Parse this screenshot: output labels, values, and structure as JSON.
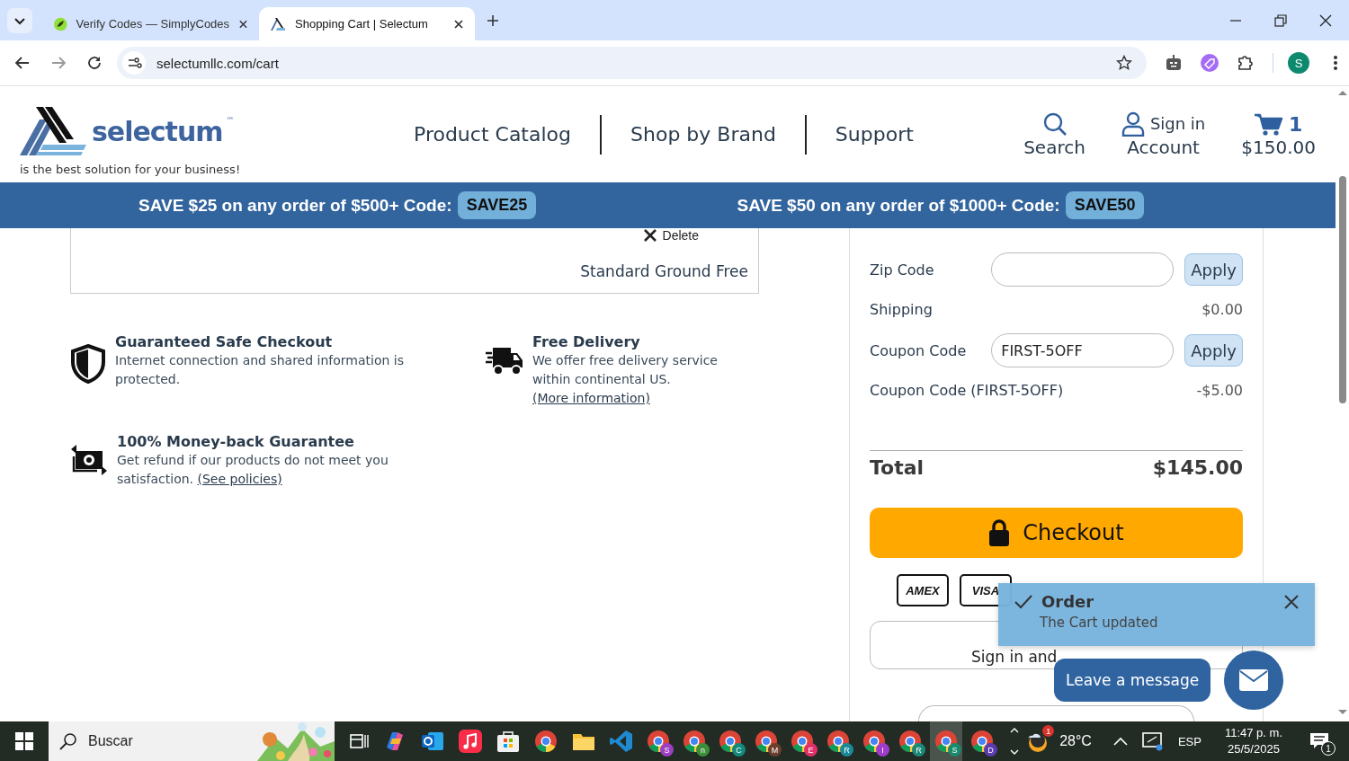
{
  "browser": {
    "tabs": [
      {
        "title": "Verify Codes — SimplyCodes",
        "selected": false
      },
      {
        "title": "Shopping Cart | Selectum",
        "selected": true
      }
    ],
    "url": "selectumllc.com/cart",
    "profile_initial": "S"
  },
  "header": {
    "logo_text": "selectum",
    "trademark": "™",
    "tagline": "is the best solution for your business!",
    "nav": [
      "Product Catalog",
      "Shop by Brand",
      "Support"
    ],
    "search_label": "Search",
    "sign_in": "Sign in",
    "account": "Account",
    "cart_count": "1",
    "cart_total": "$150.00"
  },
  "promo_banner": [
    {
      "text": "SAVE $25 on any order of $500+ Code:",
      "code": "SAVE25"
    },
    {
      "text": "SAVE $50 on any order of $1000+ Code:",
      "code": "SAVE50"
    }
  ],
  "cart_item": {
    "delete": "Delete",
    "shipping_method": "Standard Ground Free"
  },
  "features": [
    {
      "kind": "shield",
      "title": "Guaranteed Safe Checkout",
      "text": "Internet connection and shared information is protected."
    },
    {
      "kind": "truck",
      "title": "Free Delivery",
      "text": "We offer free delivery service within continental US.",
      "link": "(More information)"
    },
    {
      "kind": "money",
      "title": "100% Money-back Guarantee",
      "text": "Get refund if our products do not meet you satisfaction.",
      "link": "(See policies)"
    }
  ],
  "summary": {
    "rows": [
      {
        "kind": "input",
        "label": "Zip Code",
        "button": "Apply"
      },
      {
        "kind": "amount",
        "label": "Shipping",
        "amount": "$0.00"
      },
      {
        "kind": "input",
        "label": "Coupon Code",
        "value": "FIRST-5OFF",
        "button": "Apply"
      },
      {
        "kind": "amount",
        "label": "Coupon Code (FIRST-5OFF)",
        "amount": "-$5.00"
      }
    ],
    "total_label": "Total",
    "total": "$145.00",
    "checkout": "Checkout",
    "cards": [
      "AMEX",
      "VISA"
    ],
    "sign_in_checkout": "Sign in and"
  },
  "toast": {
    "title": "Order",
    "message": "The Cart updated"
  },
  "chat": {
    "label": "Leave a message"
  },
  "taskbar": {
    "search_placeholder": "Buscar",
    "profiles": [
      {
        "letter": "S",
        "color": "#9c3fc2",
        "selected": false
      },
      {
        "letter": "n",
        "color": "#3b8f3b",
        "selected": false
      },
      {
        "letter": "C",
        "color": "#138a7e",
        "selected": false
      },
      {
        "letter": "M",
        "color": "#6b3e2e",
        "selected": false
      },
      {
        "letter": "E",
        "color": "#e0306b",
        "selected": false
      },
      {
        "letter": "R",
        "color": "#1a8a9a",
        "selected": false
      },
      {
        "letter": "I",
        "color": "#a03ccc",
        "selected": false
      },
      {
        "letter": "R",
        "color": "#1b8a78",
        "selected": false
      },
      {
        "letter": "S",
        "color": "#1a8a6e",
        "selected": true
      },
      {
        "letter": "D",
        "color": "#5b3bb0",
        "selected": false
      }
    ],
    "weather_badge": "1",
    "weather": "28°C",
    "language": "ESP",
    "time": "11:47 p. m.",
    "date": "25/5/2025",
    "notifications": "1"
  }
}
